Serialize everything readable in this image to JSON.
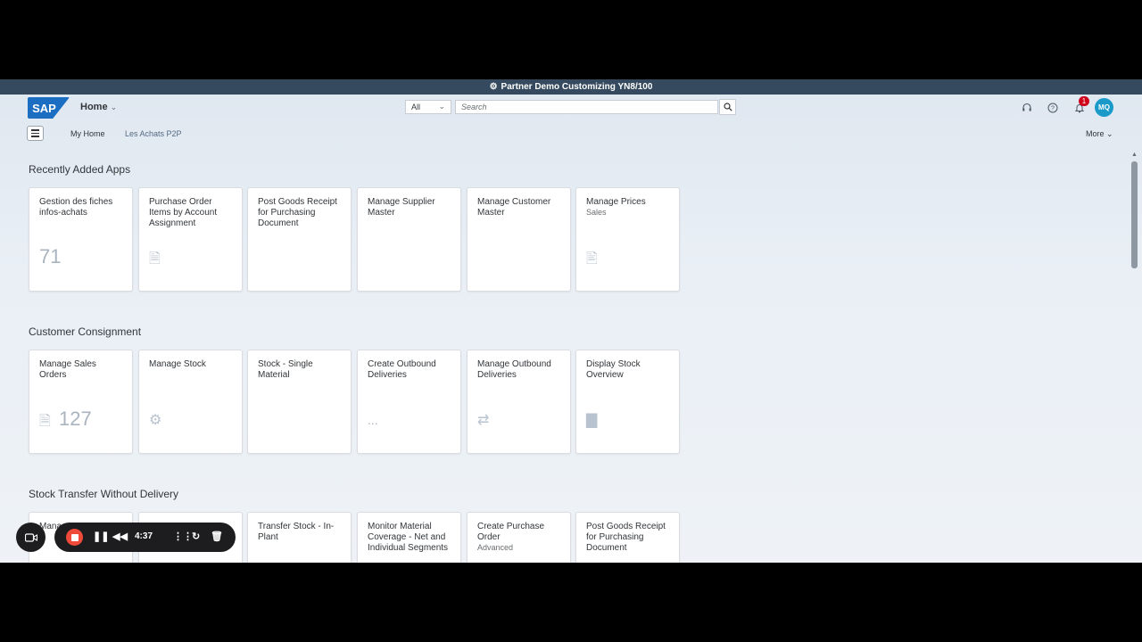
{
  "system_bar": {
    "title": "Partner Demo Customizing YN8/100"
  },
  "shell": {
    "logo": "SAP",
    "home_label": "Home",
    "search_scope": "All",
    "search_placeholder": "Search",
    "notification_count": "1",
    "user_initials": "MQ"
  },
  "nav": {
    "links": [
      "My Home",
      "Les Achats P2P"
    ],
    "more_label": "More"
  },
  "sections": [
    {
      "title": "Recently Added Apps",
      "tiles": [
        {
          "title": "Gestion des fiches infos-achats",
          "subtitle": "",
          "number": "71",
          "icon": ""
        },
        {
          "title": "Purchase Order Items by Account Assignment",
          "subtitle": "",
          "number": "",
          "icon": "document-currency-icon"
        },
        {
          "title": "Post Goods Receipt for Purchasing Document",
          "subtitle": "",
          "number": "",
          "icon": ""
        },
        {
          "title": "Manage Supplier Master",
          "subtitle": "",
          "number": "",
          "icon": ""
        },
        {
          "title": "Manage Customer Master",
          "subtitle": "",
          "number": "",
          "icon": ""
        },
        {
          "title": "Manage Prices",
          "subtitle": "Sales",
          "number": "",
          "icon": "price-list-icon"
        }
      ]
    },
    {
      "title": "Customer Consignment",
      "tiles": [
        {
          "title": "Manage Sales Orders",
          "subtitle": "",
          "number": "127",
          "icon": "sales-document-icon"
        },
        {
          "title": "Manage Stock",
          "subtitle": "",
          "number": "",
          "icon": "stock-settings-icon"
        },
        {
          "title": "Stock - Single Material",
          "subtitle": "",
          "number": "",
          "icon": ""
        },
        {
          "title": "Create Outbound Deliveries",
          "subtitle": "",
          "number": "...",
          "icon": ""
        },
        {
          "title": "Manage Outbound Deliveries",
          "subtitle": "",
          "number": "",
          "icon": "shipping-icon"
        },
        {
          "title": "Display Stock Overview",
          "subtitle": "",
          "number": "",
          "icon": "bar-chart-icon"
        }
      ]
    },
    {
      "title": "Stock Transfer Without Delivery",
      "tiles": [
        {
          "title": "Mana",
          "subtitle": "",
          "number": "",
          "icon": ""
        },
        {
          "title": "",
          "subtitle": "",
          "number": "",
          "icon": ""
        },
        {
          "title": "Transfer Stock - In-Plant",
          "subtitle": "",
          "number": "",
          "icon": ""
        },
        {
          "title": "Monitor Material Coverage - Net and Individual Segments",
          "subtitle": "",
          "number": "",
          "icon": ""
        },
        {
          "title": "Create Purchase Order",
          "subtitle": "Advanced",
          "number": "",
          "icon": ""
        },
        {
          "title": "Post Goods Receipt for Purchasing Document",
          "subtitle": "",
          "number": "",
          "icon": ""
        }
      ]
    }
  ],
  "recorder": {
    "time": "4:37"
  }
}
